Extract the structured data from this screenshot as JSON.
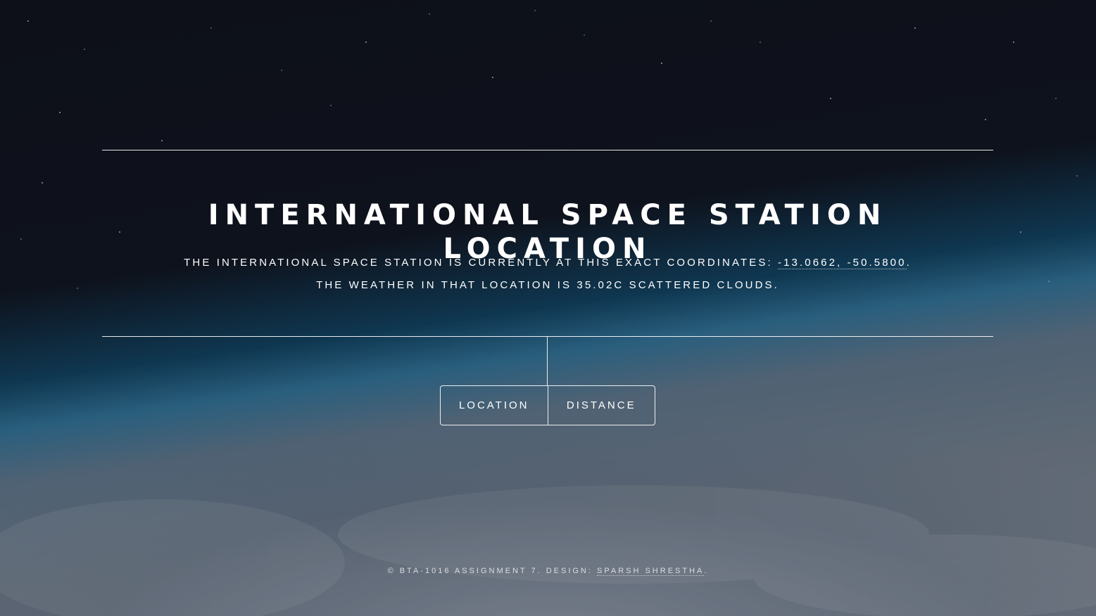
{
  "header": {
    "title": "International Space Station Location"
  },
  "description": {
    "line1_prefix": "The International Space Station is currently at this exact coordinates:",
    "coordinates": "-13.0662, -50.5800",
    "line1_suffix": ".",
    "line2": "The weather in that location is 35.02C scattered clouds."
  },
  "nav": {
    "location_label": "Location",
    "distance_label": "Distance"
  },
  "footer": {
    "prefix": "© BTA-1016 Assignment 7. Design:",
    "author": "Sparsh Shrestha",
    "suffix": "."
  },
  "colors": {
    "text": "#ffffff",
    "space": "#0c0f17",
    "atmosphere": "#2e6f92"
  }
}
